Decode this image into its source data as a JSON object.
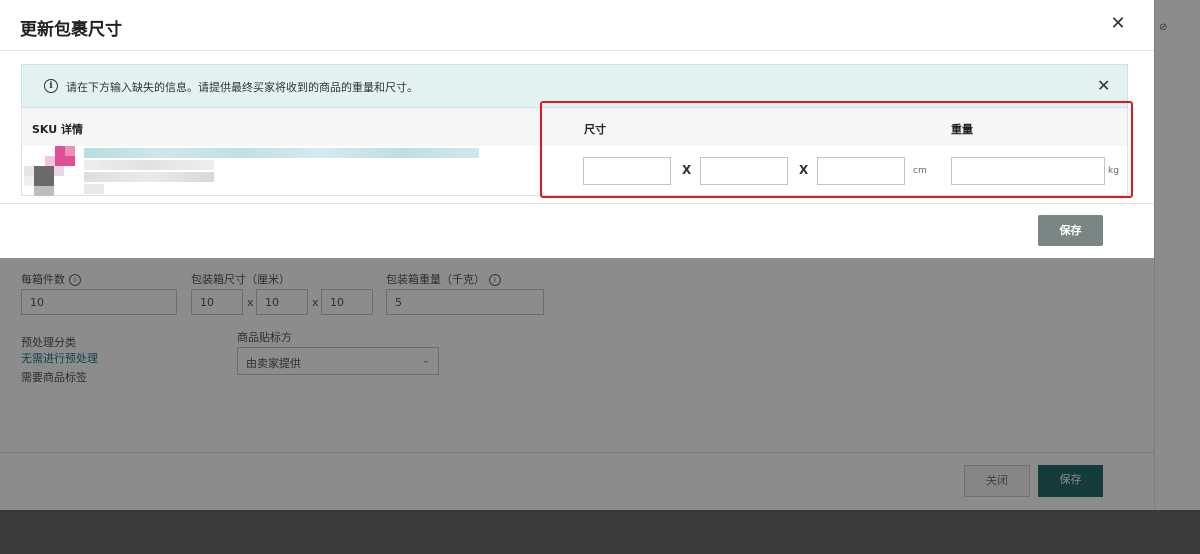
{
  "modal": {
    "title": "更新包裹尺寸",
    "close_icon": "close-icon",
    "banner": {
      "text": "请在下方输入缺失的信息。请提供最终买家将收到的商品的重量和尺寸。",
      "info_icon": "info-icon",
      "close_icon": "close-icon"
    },
    "table": {
      "col_sku": "SKU 详情",
      "col_dimensions": "尺寸",
      "col_weight": "重量"
    },
    "dimensions": {
      "length": "",
      "width": "",
      "height": "",
      "unit": "cm"
    },
    "weight": {
      "value": "",
      "unit": "kg"
    },
    "save_label": "保存"
  },
  "background_form": {
    "units_per_box_label": "每箱件数",
    "units_per_box_value": "10",
    "box_dims_label": "包装箱尺寸（厘米）",
    "box_dims": [
      "10",
      "10",
      "10"
    ],
    "x_sep": "x",
    "box_weight_label": "包装箱重量（千克）",
    "box_weight_value": "5",
    "prep_label": "预处理分类",
    "prep_link": "无需进行预处理",
    "label_required": "需要商品标签",
    "labeling_label": "商品贴标方",
    "labeling_value": "由卖家提供",
    "close_label": "关闭",
    "save_label": "保存"
  },
  "colors": {
    "accent": "#236e6b",
    "highlight": "#e0191e",
    "banner_bg": "#e3f1f1"
  }
}
